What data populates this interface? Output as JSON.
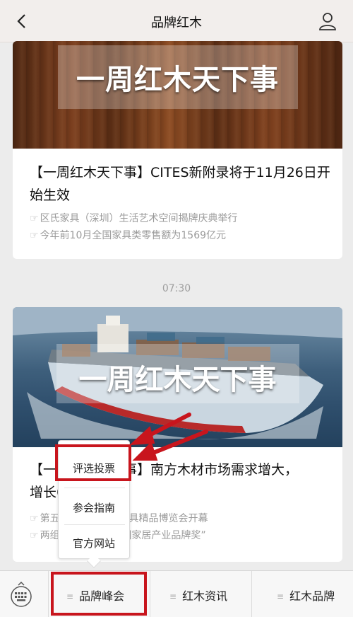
{
  "header": {
    "title": "品牌红木"
  },
  "articles": [
    {
      "banner_text": "一周红木天下事",
      "title": "【一周红木天下事】CITES新附录将于11月26日开始生效",
      "subs": [
        "区氏家具（深圳）生活艺术空间揭牌庆典举行",
        "今年前10月全国家具类零售额为1569亿元"
      ]
    },
    {
      "banner_text": "一周红木天下事",
      "title": "【一周红木天下事】南方木材市场需求增大，　　　　增长63%",
      "subs": [
        "第五　　　　红木家具精品博览会开幕",
        "两组　　　　19中国家居产业品牌奖”"
      ]
    }
  ],
  "timestamp": "07:30",
  "popup_menu": {
    "items": [
      "评选投票",
      "参会指南",
      "官方网站"
    ]
  },
  "bottom_nav": {
    "tabs": [
      "品牌峰会",
      "红木资讯",
      "红木品牌"
    ]
  },
  "colors": {
    "highlight": "#c8151d",
    "header_bg": "#f2eeec"
  }
}
